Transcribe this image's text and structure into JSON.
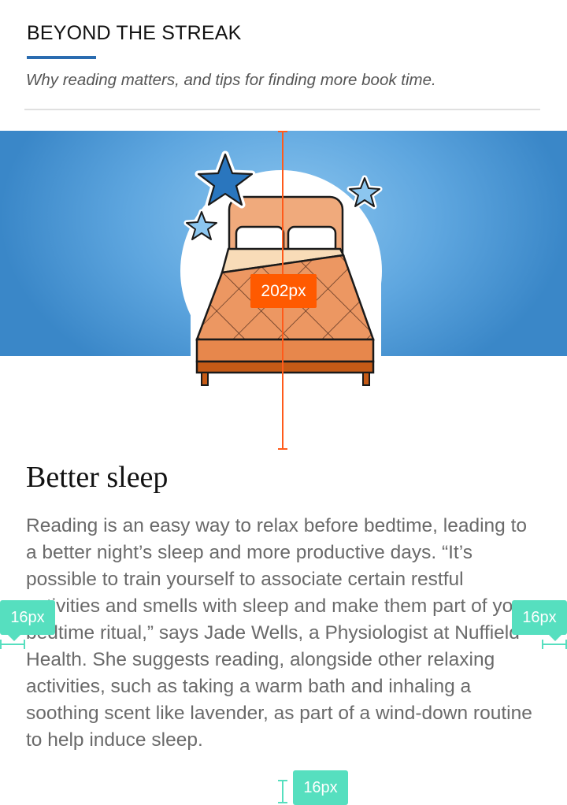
{
  "header": {
    "title": "BEYOND THE STREAK",
    "subtitle": "Why reading matters, and tips for finding more book time."
  },
  "hero": {
    "illustration_icon": "bed-with-stars-icon",
    "colors": {
      "banner": "#5ea6df",
      "headboard": "#f0aa7c",
      "blanket": "#ee9a5e",
      "frame": "#c55a16",
      "star_dark": "#2a76be",
      "star_light": "#8cc6ef"
    }
  },
  "article": {
    "heading": "Better sleep",
    "body": "Reading is an easy way to relax before bedtime, leading to a better night’s sleep and more productive days. “It’s possible to train yourself to associate certain restful activities and smells with sleep and make them part of your bedtime ritual,” says Jade Wells, a Physiologist at Nuffield Health. She suggests reading, alongside other relaxing activities, such as taking a warm bath and inhaling a soothing scent like lavender, as part of a wind-down routine to help induce sleep."
  },
  "annotations": {
    "image_height_label": "202px",
    "left_margin_label": "16px",
    "right_margin_label": "16px",
    "bottom_margin_label": "16px",
    "measure_color": "#ff5a00",
    "spacing_color": "#56dfbf"
  }
}
